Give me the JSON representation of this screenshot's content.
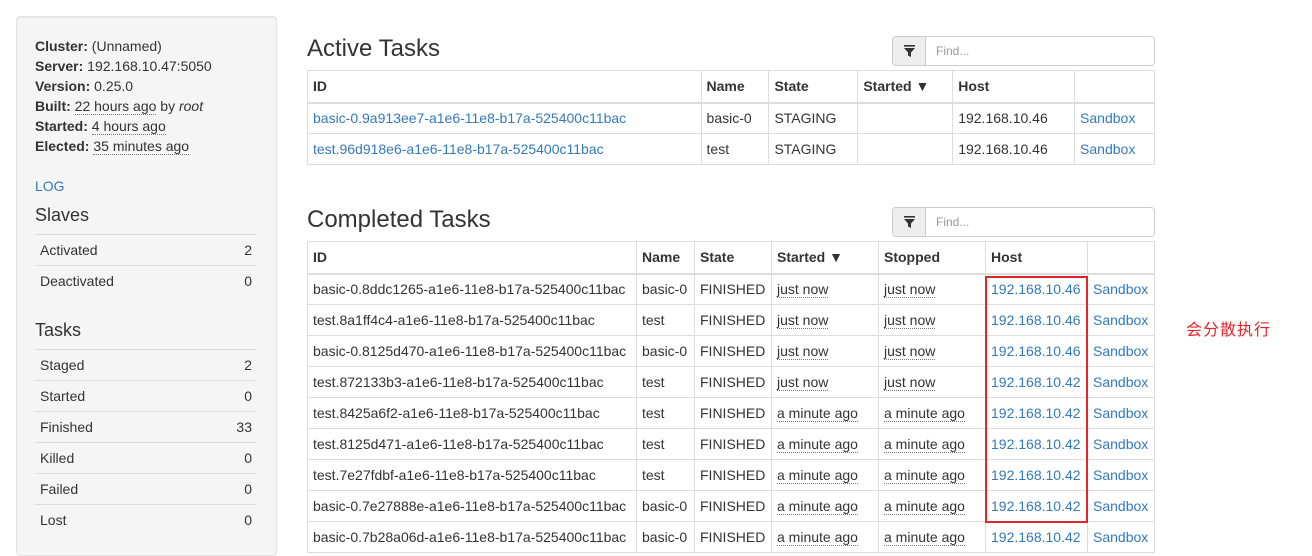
{
  "sidebar": {
    "info": {
      "cluster_label": "Cluster:",
      "cluster_value": "(Unnamed)",
      "server_label": "Server:",
      "server_value": "192.168.10.47:5050",
      "version_label": "Version:",
      "version_value": "0.25.0",
      "built_label": "Built:",
      "built_value": "22 hours ago",
      "built_by": "by",
      "built_user": "root",
      "started_label": "Started:",
      "started_value": "4 hours ago",
      "elected_label": "Elected:",
      "elected_value": "35 minutes ago"
    },
    "log_link": "LOG",
    "slaves": {
      "title": "Slaves",
      "rows": [
        {
          "label": "Activated",
          "value": "2"
        },
        {
          "label": "Deactivated",
          "value": "0"
        }
      ]
    },
    "tasks": {
      "title": "Tasks",
      "rows": [
        {
          "label": "Staged",
          "value": "2"
        },
        {
          "label": "Started",
          "value": "0"
        },
        {
          "label": "Finished",
          "value": "33"
        },
        {
          "label": "Killed",
          "value": "0"
        },
        {
          "label": "Failed",
          "value": "0"
        },
        {
          "label": "Lost",
          "value": "0"
        }
      ]
    }
  },
  "active_tasks": {
    "title": "Active Tasks",
    "filter_icon": "filter-icon",
    "filter_placeholder": "Find...",
    "columns": [
      "ID",
      "Name",
      "State",
      "Started ▼",
      "Host",
      ""
    ],
    "rows": [
      {
        "id": "basic-0.9a913ee7-a1e6-11e8-b17a-525400c11bac",
        "name": "basic-0",
        "state": "STAGING",
        "started": "",
        "host": "192.168.10.46",
        "sandbox": "Sandbox"
      },
      {
        "id": "test.96d918e6-a1e6-11e8-b17a-525400c11bac",
        "name": "test",
        "state": "STAGING",
        "started": "",
        "host": "192.168.10.46",
        "sandbox": "Sandbox"
      }
    ]
  },
  "completed_tasks": {
    "title": "Completed Tasks",
    "filter_icon": "filter-icon",
    "filter_placeholder": "Find...",
    "columns": [
      "ID",
      "Name",
      "State",
      "Started ▼",
      "Stopped",
      "Host",
      ""
    ],
    "rows": [
      {
        "id": "basic-0.8ddc1265-a1e6-11e8-b17a-525400c11bac",
        "name": "basic-0",
        "state": "FINISHED",
        "started": "just now",
        "stopped": "just now",
        "host": "192.168.10.46",
        "sandbox": "Sandbox"
      },
      {
        "id": "test.8a1ff4c4-a1e6-11e8-b17a-525400c11bac",
        "name": "test",
        "state": "FINISHED",
        "started": "just now",
        "stopped": "just now",
        "host": "192.168.10.46",
        "sandbox": "Sandbox"
      },
      {
        "id": "basic-0.8125d470-a1e6-11e8-b17a-525400c11bac",
        "name": "basic-0",
        "state": "FINISHED",
        "started": "just now",
        "stopped": "just now",
        "host": "192.168.10.46",
        "sandbox": "Sandbox"
      },
      {
        "id": "test.872133b3-a1e6-11e8-b17a-525400c11bac",
        "name": "test",
        "state": "FINISHED",
        "started": "just now",
        "stopped": "just now",
        "host": "192.168.10.42",
        "sandbox": "Sandbox"
      },
      {
        "id": "test.8425a6f2-a1e6-11e8-b17a-525400c11bac",
        "name": "test",
        "state": "FINISHED",
        "started": "a minute ago",
        "stopped": "a minute ago",
        "host": "192.168.10.42",
        "sandbox": "Sandbox"
      },
      {
        "id": "test.8125d471-a1e6-11e8-b17a-525400c11bac",
        "name": "test",
        "state": "FINISHED",
        "started": "a minute ago",
        "stopped": "a minute ago",
        "host": "192.168.10.42",
        "sandbox": "Sandbox"
      },
      {
        "id": "test.7e27fdbf-a1e6-11e8-b17a-525400c11bac",
        "name": "test",
        "state": "FINISHED",
        "started": "a minute ago",
        "stopped": "a minute ago",
        "host": "192.168.10.42",
        "sandbox": "Sandbox"
      },
      {
        "id": "basic-0.7e27888e-a1e6-11e8-b17a-525400c11bac",
        "name": "basic-0",
        "state": "FINISHED",
        "started": "a minute ago",
        "stopped": "a minute ago",
        "host": "192.168.10.42",
        "sandbox": "Sandbox"
      },
      {
        "id": "basic-0.7b28a06d-a1e6-11e8-b17a-525400c11bac",
        "name": "basic-0",
        "state": "FINISHED",
        "started": "a minute ago",
        "stopped": "a minute ago",
        "host": "192.168.10.42",
        "sandbox": "Sandbox"
      }
    ]
  },
  "annotation": {
    "text": "会分散执行",
    "color": "#e0252b"
  },
  "colors": {
    "link": "#337ab7",
    "highlight": "#e0252b"
  }
}
